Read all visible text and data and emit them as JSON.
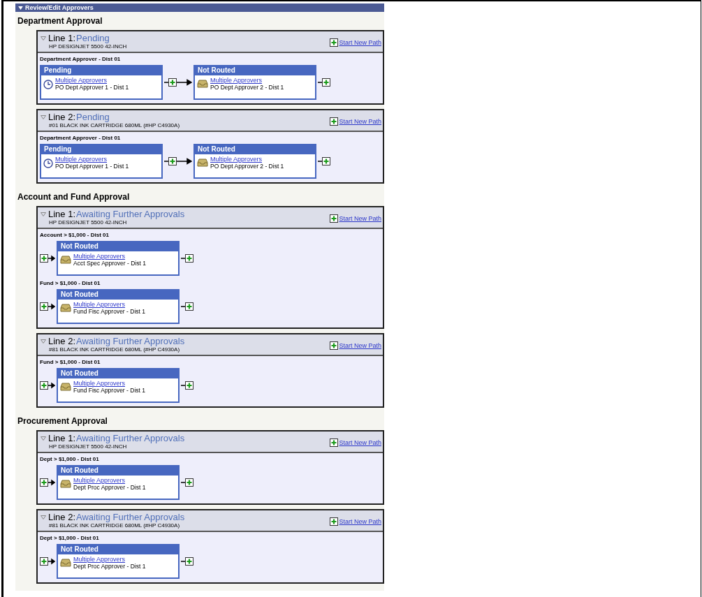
{
  "panel": {
    "title": "Review/Edit Approvers",
    "expanded": true
  },
  "sections": [
    {
      "title": "Department Approval",
      "lines": [
        {
          "label": "Line 1:",
          "status": "Pending",
          "description": "HP DESIGNJET 5500 42-INCH",
          "expanded": true,
          "action": "Start New Path",
          "paths": [
            {
              "title": "Department Approver - Dist 01",
              "start_insert": false,
              "steps": [
                {
                  "kind": "pending",
                  "status": "Pending",
                  "link": "Multiple Approvers",
                  "approver": "PO Dept Approver 1 - Dist 1"
                },
                {
                  "kind": "not_routed",
                  "status": "Not Routed",
                  "link": "Multiple Approvers",
                  "approver": "PO Dept Approver 2 - Dist 1"
                }
              ]
            }
          ]
        },
        {
          "label": "Line 2:",
          "status": "Pending",
          "description": "#01 BLACK INK CARTRIDGE 680ML (#HP C4930A)",
          "expanded": true,
          "action": "Start New Path",
          "paths": [
            {
              "title": "Department Approver - Dist 01",
              "start_insert": false,
              "steps": [
                {
                  "kind": "pending",
                  "status": "Pending",
                  "link": "Multiple Approvers",
                  "approver": "PO Dept Approver 1 - Dist 1"
                },
                {
                  "kind": "not_routed",
                  "status": "Not Routed",
                  "link": "Multiple Approvers",
                  "approver": "PO Dept Approver 2 - Dist 1"
                }
              ]
            }
          ]
        }
      ]
    },
    {
      "title": "Account and Fund Approval",
      "lines": [
        {
          "label": "Line 1:",
          "status": "Awaiting Further Approvals",
          "description": "HP DESIGNJET 5500 42-INCH",
          "expanded": true,
          "action": "Start New Path",
          "paths": [
            {
              "title": "Account > $1,000 - Dist 01",
              "start_insert": true,
              "steps": [
                {
                  "kind": "not_routed",
                  "status": "Not Routed",
                  "link": "Multiple Approvers",
                  "approver": "Acct Spec Approver - Dist 1"
                }
              ]
            },
            {
              "title": "Fund > $1,000 - Dist 01",
              "start_insert": true,
              "steps": [
                {
                  "kind": "not_routed",
                  "status": "Not Routed",
                  "link": "Multiple Approvers",
                  "approver": "Fund Fisc Approver - Dist 1"
                }
              ]
            }
          ]
        },
        {
          "label": "Line 2:",
          "status": "Awaiting Further Approvals",
          "description": "#81 BLACK INK CARTRIDGE 680ML (#HP C4930A)",
          "expanded": true,
          "action": "Start New Path",
          "paths": [
            {
              "title": "Fund > $1,000 - Dist 01",
              "start_insert": true,
              "steps": [
                {
                  "kind": "not_routed",
                  "status": "Not Routed",
                  "link": "Multiple Approvers",
                  "approver": "Fund Fisc Approver - Dist 1"
                }
              ]
            }
          ]
        }
      ]
    },
    {
      "title": "Procurement Approval",
      "lines": [
        {
          "label": "Line 1:",
          "status": "Awaiting Further Approvals",
          "description": "HP DESIGNJET 5500 42-INCH",
          "expanded": true,
          "action": "Start New Path",
          "paths": [
            {
              "title": "Dept > $1,000 - Dist 01",
              "start_insert": true,
              "steps": [
                {
                  "kind": "not_routed",
                  "status": "Not Routed",
                  "link": "Multiple Approvers",
                  "approver": "Dept Proc Approver - Dist 1"
                }
              ]
            }
          ]
        },
        {
          "label": "Line 2:",
          "status": "Awaiting Further Approvals",
          "description": "#81 BLACK INK CARTRIDGE 680ML (#HP C4930A)",
          "expanded": true,
          "action": "Start New Path",
          "paths": [
            {
              "title": "Dept > $1,000 - Dist 01",
              "start_insert": true,
              "steps": [
                {
                  "kind": "not_routed",
                  "status": "Not Routed",
                  "link": "Multiple Approvers",
                  "approver": "Dept Proc Approver - Dist 1"
                }
              ]
            }
          ]
        }
      ]
    }
  ]
}
